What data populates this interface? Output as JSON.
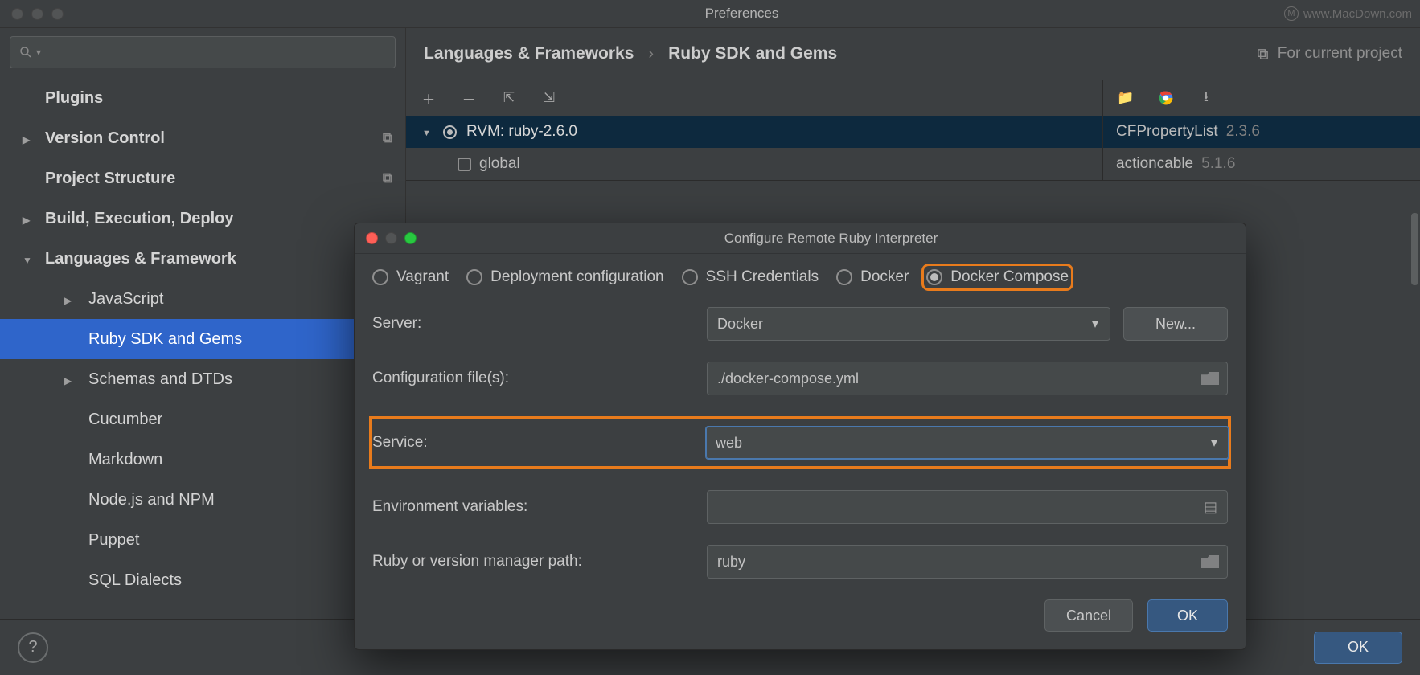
{
  "prefs": {
    "title": "Preferences",
    "watermark": "www.MacDown.com",
    "sidebar": {
      "search_placeholder": "",
      "items": [
        {
          "label": "Plugins",
          "kind": "top",
          "arrow": false
        },
        {
          "label": "Version Control",
          "kind": "top",
          "arrow": true,
          "collapsed": true,
          "badge": "⧉"
        },
        {
          "label": "Project Structure",
          "kind": "top",
          "arrow": false,
          "badge": "⧉"
        },
        {
          "label": "Build, Execution, Deploy",
          "kind": "top",
          "arrow": true,
          "collapsed": true
        },
        {
          "label": "Languages & Framework",
          "kind": "top",
          "arrow": true,
          "collapsed": false
        },
        {
          "label": "JavaScript",
          "kind": "child",
          "arrow": true,
          "collapsed": true
        },
        {
          "label": "Ruby SDK and Gems",
          "kind": "child",
          "arrow": false,
          "selected": true
        },
        {
          "label": "Schemas and DTDs",
          "kind": "child",
          "arrow": true,
          "collapsed": true
        },
        {
          "label": "Cucumber",
          "kind": "child",
          "arrow": false
        },
        {
          "label": "Markdown",
          "kind": "child",
          "arrow": false
        },
        {
          "label": "Node.js and NPM",
          "kind": "child",
          "arrow": false
        },
        {
          "label": "Puppet",
          "kind": "child",
          "arrow": false
        },
        {
          "label": "SQL Dialects",
          "kind": "child",
          "arrow": false
        }
      ]
    },
    "breadcrumb": {
      "a": "Languages & Frameworks",
      "b": "Ruby SDK and Gems",
      "scope": "For current project"
    },
    "sdk": {
      "selected": "RVM: ruby-2.6.0",
      "child": "global",
      "gems": [
        {
          "name": "CFPropertyList",
          "ver": "2.3.6",
          "sel": true
        },
        {
          "name": "actioncable",
          "ver": "5.1.6"
        }
      ]
    },
    "footer": {
      "ok": "OK"
    }
  },
  "modal": {
    "title": "Configure Remote Ruby Interpreter",
    "conn": {
      "vagrant": "Vagrant",
      "deploy": "Deployment configuration",
      "ssh": "SSH Credentials",
      "docker": "Docker",
      "compose": "Docker Compose"
    },
    "labels": {
      "server": "Server:",
      "config": "Configuration file(s):",
      "service": "Service:",
      "env": "Environment variables:",
      "ruby": "Ruby or version manager path:"
    },
    "values": {
      "server": "Docker",
      "config": "./docker-compose.yml",
      "service": "web",
      "env": "",
      "ruby": "ruby",
      "new": "New..."
    },
    "buttons": {
      "cancel": "Cancel",
      "ok": "OK"
    }
  }
}
